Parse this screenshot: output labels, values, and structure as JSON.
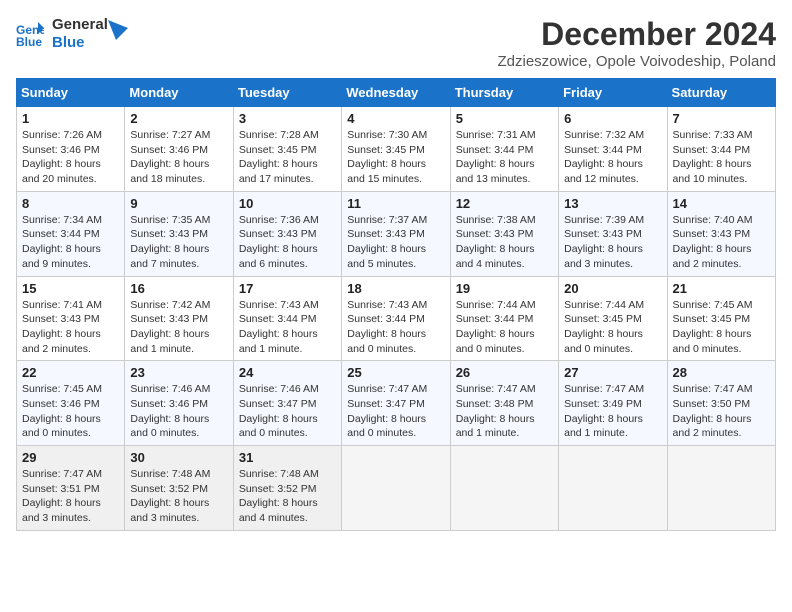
{
  "header": {
    "logo_line1": "General",
    "logo_line2": "Blue",
    "month_title": "December 2024",
    "subtitle": "Zdzieszowice, Opole Voivodeship, Poland"
  },
  "days_of_week": [
    "Sunday",
    "Monday",
    "Tuesday",
    "Wednesday",
    "Thursday",
    "Friday",
    "Saturday"
  ],
  "weeks": [
    [
      {
        "day": "1",
        "sunrise": "Sunrise: 7:26 AM",
        "sunset": "Sunset: 3:46 PM",
        "daylight": "Daylight: 8 hours and 20 minutes."
      },
      {
        "day": "2",
        "sunrise": "Sunrise: 7:27 AM",
        "sunset": "Sunset: 3:46 PM",
        "daylight": "Daylight: 8 hours and 18 minutes."
      },
      {
        "day": "3",
        "sunrise": "Sunrise: 7:28 AM",
        "sunset": "Sunset: 3:45 PM",
        "daylight": "Daylight: 8 hours and 17 minutes."
      },
      {
        "day": "4",
        "sunrise": "Sunrise: 7:30 AM",
        "sunset": "Sunset: 3:45 PM",
        "daylight": "Daylight: 8 hours and 15 minutes."
      },
      {
        "day": "5",
        "sunrise": "Sunrise: 7:31 AM",
        "sunset": "Sunset: 3:44 PM",
        "daylight": "Daylight: 8 hours and 13 minutes."
      },
      {
        "day": "6",
        "sunrise": "Sunrise: 7:32 AM",
        "sunset": "Sunset: 3:44 PM",
        "daylight": "Daylight: 8 hours and 12 minutes."
      },
      {
        "day": "7",
        "sunrise": "Sunrise: 7:33 AM",
        "sunset": "Sunset: 3:44 PM",
        "daylight": "Daylight: 8 hours and 10 minutes."
      }
    ],
    [
      {
        "day": "8",
        "sunrise": "Sunrise: 7:34 AM",
        "sunset": "Sunset: 3:44 PM",
        "daylight": "Daylight: 8 hours and 9 minutes."
      },
      {
        "day": "9",
        "sunrise": "Sunrise: 7:35 AM",
        "sunset": "Sunset: 3:43 PM",
        "daylight": "Daylight: 8 hours and 7 minutes."
      },
      {
        "day": "10",
        "sunrise": "Sunrise: 7:36 AM",
        "sunset": "Sunset: 3:43 PM",
        "daylight": "Daylight: 8 hours and 6 minutes."
      },
      {
        "day": "11",
        "sunrise": "Sunrise: 7:37 AM",
        "sunset": "Sunset: 3:43 PM",
        "daylight": "Daylight: 8 hours and 5 minutes."
      },
      {
        "day": "12",
        "sunrise": "Sunrise: 7:38 AM",
        "sunset": "Sunset: 3:43 PM",
        "daylight": "Daylight: 8 hours and 4 minutes."
      },
      {
        "day": "13",
        "sunrise": "Sunrise: 7:39 AM",
        "sunset": "Sunset: 3:43 PM",
        "daylight": "Daylight: 8 hours and 3 minutes."
      },
      {
        "day": "14",
        "sunrise": "Sunrise: 7:40 AM",
        "sunset": "Sunset: 3:43 PM",
        "daylight": "Daylight: 8 hours and 2 minutes."
      }
    ],
    [
      {
        "day": "15",
        "sunrise": "Sunrise: 7:41 AM",
        "sunset": "Sunset: 3:43 PM",
        "daylight": "Daylight: 8 hours and 2 minutes."
      },
      {
        "day": "16",
        "sunrise": "Sunrise: 7:42 AM",
        "sunset": "Sunset: 3:43 PM",
        "daylight": "Daylight: 8 hours and 1 minute."
      },
      {
        "day": "17",
        "sunrise": "Sunrise: 7:43 AM",
        "sunset": "Sunset: 3:44 PM",
        "daylight": "Daylight: 8 hours and 1 minute."
      },
      {
        "day": "18",
        "sunrise": "Sunrise: 7:43 AM",
        "sunset": "Sunset: 3:44 PM",
        "daylight": "Daylight: 8 hours and 0 minutes."
      },
      {
        "day": "19",
        "sunrise": "Sunrise: 7:44 AM",
        "sunset": "Sunset: 3:44 PM",
        "daylight": "Daylight: 8 hours and 0 minutes."
      },
      {
        "day": "20",
        "sunrise": "Sunrise: 7:44 AM",
        "sunset": "Sunset: 3:45 PM",
        "daylight": "Daylight: 8 hours and 0 minutes."
      },
      {
        "day": "21",
        "sunrise": "Sunrise: 7:45 AM",
        "sunset": "Sunset: 3:45 PM",
        "daylight": "Daylight: 8 hours and 0 minutes."
      }
    ],
    [
      {
        "day": "22",
        "sunrise": "Sunrise: 7:45 AM",
        "sunset": "Sunset: 3:46 PM",
        "daylight": "Daylight: 8 hours and 0 minutes."
      },
      {
        "day": "23",
        "sunrise": "Sunrise: 7:46 AM",
        "sunset": "Sunset: 3:46 PM",
        "daylight": "Daylight: 8 hours and 0 minutes."
      },
      {
        "day": "24",
        "sunrise": "Sunrise: 7:46 AM",
        "sunset": "Sunset: 3:47 PM",
        "daylight": "Daylight: 8 hours and 0 minutes."
      },
      {
        "day": "25",
        "sunrise": "Sunrise: 7:47 AM",
        "sunset": "Sunset: 3:47 PM",
        "daylight": "Daylight: 8 hours and 0 minutes."
      },
      {
        "day": "26",
        "sunrise": "Sunrise: 7:47 AM",
        "sunset": "Sunset: 3:48 PM",
        "daylight": "Daylight: 8 hours and 1 minute."
      },
      {
        "day": "27",
        "sunrise": "Sunrise: 7:47 AM",
        "sunset": "Sunset: 3:49 PM",
        "daylight": "Daylight: 8 hours and 1 minute."
      },
      {
        "day": "28",
        "sunrise": "Sunrise: 7:47 AM",
        "sunset": "Sunset: 3:50 PM",
        "daylight": "Daylight: 8 hours and 2 minutes."
      }
    ],
    [
      {
        "day": "29",
        "sunrise": "Sunrise: 7:47 AM",
        "sunset": "Sunset: 3:51 PM",
        "daylight": "Daylight: 8 hours and 3 minutes."
      },
      {
        "day": "30",
        "sunrise": "Sunrise: 7:48 AM",
        "sunset": "Sunset: 3:52 PM",
        "daylight": "Daylight: 8 hours and 3 minutes."
      },
      {
        "day": "31",
        "sunrise": "Sunrise: 7:48 AM",
        "sunset": "Sunset: 3:52 PM",
        "daylight": "Daylight: 8 hours and 4 minutes."
      },
      null,
      null,
      null,
      null
    ]
  ]
}
